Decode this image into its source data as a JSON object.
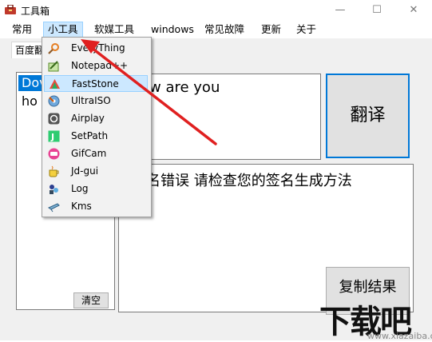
{
  "window": {
    "title": "工具箱",
    "minimize": "—",
    "maximize": "☐",
    "close": "✕"
  },
  "menu": [
    "常用",
    "小工具",
    "软媒工具",
    "windows",
    "常见故障",
    "更新",
    "关于"
  ],
  "tab": {
    "label": "百度翻"
  },
  "left_list": {
    "selected": "Dov",
    "item2": "ho"
  },
  "clear_button": "清空",
  "input_text": "w are you",
  "translate_button": "翻译",
  "output_text": "名错误   请检查您的签名生成方法",
  "copy_button": "复制结果",
  "dropdown_items": [
    {
      "label": "EveryThing",
      "icon": "everything-icon"
    },
    {
      "label": "Notepad++",
      "icon": "notepad-icon"
    },
    {
      "label": "FastStone",
      "icon": "faststone-icon",
      "highlighted": true
    },
    {
      "label": "UltraISO",
      "icon": "ultraiso-icon"
    },
    {
      "label": "Airplay",
      "icon": "airplay-icon"
    },
    {
      "label": "SetPath",
      "icon": "setpath-icon"
    },
    {
      "label": "GifCam",
      "icon": "gifcam-icon"
    },
    {
      "label": "Jd-gui",
      "icon": "jdgui-icon"
    },
    {
      "label": "Log",
      "icon": "log-icon"
    },
    {
      "label": "Kms",
      "icon": "kms-icon"
    }
  ],
  "watermark": {
    "main": "下载吧",
    "sub": "www.xiazaiba.com"
  },
  "colors": {
    "accent": "#0078d7",
    "arrow": "#e02020",
    "hover": "#cce8ff"
  }
}
